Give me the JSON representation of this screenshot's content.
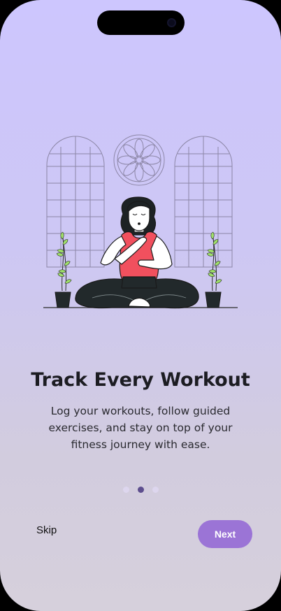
{
  "onboarding": {
    "title": "Track Every Workout",
    "description": "Log your workouts, follow guided exercises, and stay on top of your fitness journey with ease.",
    "pagination": {
      "total": 3,
      "current": 2
    },
    "skip_label": "Skip",
    "next_label": "Next",
    "illustration": "meditating-woman-illustration"
  },
  "colors": {
    "background_top": "#cdc6fe",
    "background_bottom": "#d6d0dc",
    "accent": "#9b74d6",
    "dot_active": "#5d4e8e",
    "dot_inactive": "#ddd6ee",
    "title_text": "#1c1c22"
  }
}
